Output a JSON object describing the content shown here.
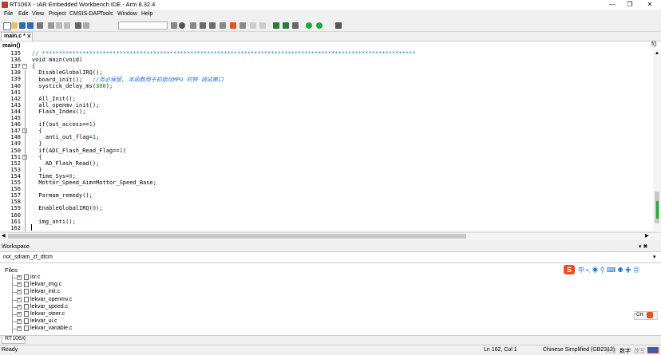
{
  "window": {
    "title": "RT106X - IAR Embedded Workbench IDE - Arm 8.32.4",
    "minimize": "—",
    "restore": "❐",
    "close": "✕"
  },
  "menu": [
    "File",
    "Edit",
    "View",
    "Project",
    "CMSIS-DAP",
    "Tools",
    "Window",
    "Help"
  ],
  "tab": {
    "label": "main.c *",
    "close": "✕"
  },
  "function_bar": {
    "value": "main()",
    "right_icon": "f()"
  },
  "code_lines": [
    {
      "n": "135",
      "t": "// ***************************************************************************************************************",
      "cls": "sep"
    },
    {
      "n": "136",
      "t": "void main(void)"
    },
    {
      "n": "137",
      "t": "{",
      "fold": "−"
    },
    {
      "n": "138",
      "t": "  DisableGlobalIRQ();"
    },
    {
      "n": "139",
      "t": "  board_init();   ",
      "c": "//务必保留, 本函数用于初始化MPU 时钟 调试串口"
    },
    {
      "n": "140",
      "t": "  systick_delay_ms(300);"
    },
    {
      "n": "141",
      "t": ""
    },
    {
      "n": "142",
      "t": "  All_Init();"
    },
    {
      "n": "143",
      "t": "  all_openmv_init();"
    },
    {
      "n": "144",
      "t": "  Flash_Index();"
    },
    {
      "n": "145",
      "t": ""
    },
    {
      "n": "146",
      "t": "  if(out_access==1)"
    },
    {
      "n": "147",
      "t": "  {",
      "fold": "−"
    },
    {
      "n": "148",
      "t": "    anti_out_flag=1;"
    },
    {
      "n": "149",
      "t": "  }"
    },
    {
      "n": "150",
      "t": "  if(ADC_Flash_Read_Flag==1)"
    },
    {
      "n": "151",
      "t": "  {",
      "fold": "−"
    },
    {
      "n": "152",
      "t": "    AD_Flash_Read();"
    },
    {
      "n": "153",
      "t": "  }"
    },
    {
      "n": "154",
      "t": "  Time_Sys=0;"
    },
    {
      "n": "155",
      "t": "  Mottor_Speed_Aim=Mottor_Speed_Base;"
    },
    {
      "n": "156",
      "t": ""
    },
    {
      "n": "157",
      "t": "  Parmam_remedy();"
    },
    {
      "n": "158",
      "t": ""
    },
    {
      "n": "159",
      "t": "  EnableGlobalIRQ(0);"
    },
    {
      "n": "160",
      "t": ""
    },
    {
      "n": "161",
      "t": "  img_anti();"
    },
    {
      "n": "162",
      "t": ""
    }
  ],
  "workspace": {
    "header": "Workspace",
    "header_icons": "▾ ✖",
    "project": "nor_sdram_zf_dtcm",
    "files_label": "Files",
    "files": [
      "isr.c",
      "lekvar_img.c",
      "lekvar_init.c",
      "lekvar_openmv.c",
      "lekvar_speed.c",
      "lekvar_steer.c",
      "lekvar_ui.c",
      "lekvar_variable.c"
    ]
  },
  "bottom_tab": "RT106X",
  "ime": {
    "logo": "S",
    "items": "中 •, ◉ ⚲ ⌨ ⚉ ✚ ▦"
  },
  "status": {
    "left": "Ready",
    "position": "Ln 162, Col 1",
    "encoding": "Chinese Simplified (GB2312)",
    "caps": "大写",
    "num": "数字",
    "ovr": "改写"
  },
  "colors": {
    "accent": "#1e73d6",
    "ime": "#e8501e",
    "run": "#21a83b"
  }
}
